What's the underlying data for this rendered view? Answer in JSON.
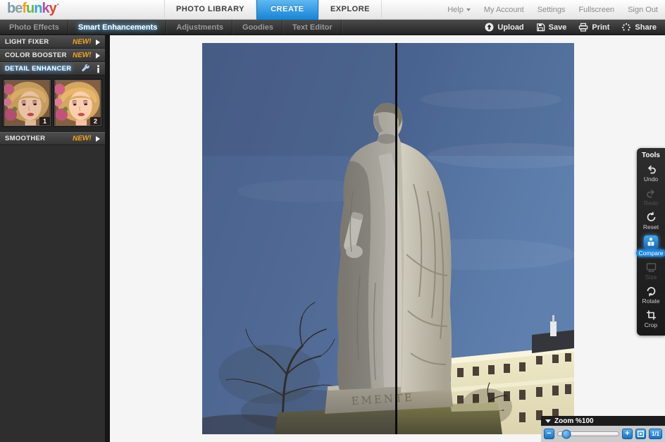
{
  "app": {
    "logo_letters": [
      {
        "ch": "b",
        "color": "#7b99a8"
      },
      {
        "ch": "e",
        "color": "#8fa0a6"
      },
      {
        "ch": "f",
        "color": "#efa126"
      },
      {
        "ch": "u",
        "color": "#6fb644"
      },
      {
        "ch": "n",
        "color": "#2fa8dc"
      },
      {
        "ch": "k",
        "color": "#b44fa0"
      },
      {
        "ch": "y",
        "color": "#e2432f"
      }
    ],
    "logo_dot": "•"
  },
  "header": {
    "nav_tabs": [
      {
        "label": "PHOTO LIBRARY",
        "state": "normal"
      },
      {
        "label": "CREATE",
        "state": "active"
      },
      {
        "label": "EXPLORE",
        "state": "normal"
      }
    ],
    "links": {
      "help": "Help",
      "my_account": "My Account",
      "settings": "Settings",
      "fullscreen": "Fullscreen",
      "sign_out": "Sign Out"
    }
  },
  "toolbar": {
    "tabs": [
      {
        "label": "Photo Effects",
        "state": "normal"
      },
      {
        "label": "Smart Enhancements",
        "state": "active"
      },
      {
        "label": "Adjustments",
        "state": "normal"
      },
      {
        "label": "Goodies",
        "state": "normal"
      },
      {
        "label": "Text Editor",
        "state": "normal"
      }
    ],
    "actions": [
      {
        "label": "Upload"
      },
      {
        "label": "Save"
      },
      {
        "label": "Print"
      },
      {
        "label": "Share"
      }
    ]
  },
  "sidebar": {
    "items": [
      {
        "label": "LIGHT FIXER",
        "badge": "NEW!",
        "state": "normal"
      },
      {
        "label": "COLOR BOOSTER",
        "badge": "NEW!",
        "state": "normal"
      },
      {
        "label": "DETAIL ENHANCER",
        "badge": "",
        "state": "selected"
      },
      {
        "label": "SMOOTHER",
        "badge": "NEW!",
        "state": "normal"
      }
    ],
    "thumbnails": [
      {
        "number": "1"
      },
      {
        "number": "2"
      }
    ]
  },
  "tools": {
    "title": "Tools",
    "items": [
      {
        "label": "Undo",
        "state": "normal"
      },
      {
        "label": "Redo",
        "state": "disabled"
      },
      {
        "label": "Reset",
        "state": "normal"
      },
      {
        "label": "Compare",
        "state": "active"
      },
      {
        "label": "Size",
        "state": "disabled"
      },
      {
        "label": "Rotate",
        "state": "normal"
      },
      {
        "label": "Crop",
        "state": "normal"
      }
    ]
  },
  "zoom": {
    "title": "Zoom %100",
    "percent": 100,
    "minus": "−",
    "plus": "+",
    "actual": "1/1"
  },
  "photo": {
    "inscription": "EMENTE"
  },
  "colors": {
    "accent_blue": "#1d86e0",
    "new_badge": "#f2a51e",
    "active_glow": "#5ab8ff",
    "create_tab": "#1583d6",
    "sidebar_bg": "#2e2e2e",
    "canvas_bg": "#f5f5f5"
  }
}
